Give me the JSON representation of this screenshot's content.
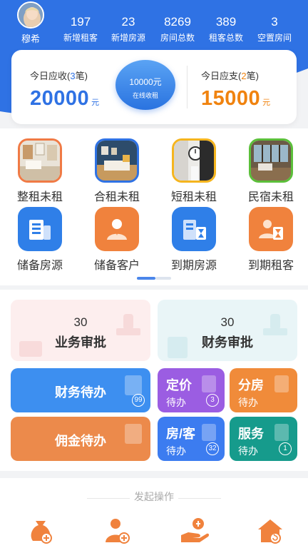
{
  "user": {
    "name": "穆希"
  },
  "stats": [
    {
      "value": "197",
      "label": "新增租客"
    },
    {
      "value": "23",
      "label": "新增房源"
    },
    {
      "value": "8269",
      "label": "房间总数"
    },
    {
      "value": "389",
      "label": "租客总数"
    },
    {
      "value": "3",
      "label": "空置房间"
    }
  ],
  "finance": {
    "receivable": {
      "label_prefix": "今日应收(",
      "count": "3",
      "label_suffix": "笔)",
      "amount": "20000",
      "unit": "元"
    },
    "payable": {
      "label_prefix": "今日应支(",
      "count": "2",
      "label_suffix": "笔)",
      "amount": "15000",
      "unit": "元"
    },
    "online": {
      "amount": "10000元",
      "label": "在线收租"
    }
  },
  "tiles_row1": [
    {
      "label": "整租未租",
      "icon": "whole-rent-photo",
      "border": "#f07a45"
    },
    {
      "label": "合租未租",
      "icon": "shared-rent-photo",
      "border": "#2f72e4"
    },
    {
      "label": "短租未租",
      "icon": "short-rent-photo",
      "border": "#f5b51e"
    },
    {
      "label": "民宿未租",
      "icon": "homestay-photo",
      "border": "#5bbf3a"
    }
  ],
  "tiles_row2": [
    {
      "label": "储备房源",
      "icon": "building-icon"
    },
    {
      "label": "储备客户",
      "icon": "customer-icon"
    },
    {
      "label": "到期房源",
      "icon": "expiring-building-icon"
    },
    {
      "label": "到期租客",
      "icon": "expiring-tenant-icon"
    }
  ],
  "approvals": [
    {
      "count": "30",
      "label": "业务审批",
      "bg": "#fdeeee"
    },
    {
      "count": "30",
      "label": "财务审批",
      "bg": "#e9f5f7"
    }
  ],
  "todos": {
    "finance": {
      "label": "财务待办",
      "badge": "99",
      "color": "#3d8ff0"
    },
    "commission": {
      "label": "佣金待办",
      "color": "#ec8a4b"
    },
    "pricing": {
      "line1": "定价",
      "line2": "待办",
      "badge": "3",
      "color": "#9b5de2"
    },
    "assign": {
      "line1": "分房",
      "line2": "待办",
      "color": "#f08b3a"
    },
    "room_tenant": {
      "line1": "房/客",
      "line2": "待办",
      "badge": "32",
      "color": "#3c7cf0"
    },
    "service": {
      "line1": "服务",
      "line2": "待办",
      "badge": "1",
      "color": "#169b8c"
    }
  },
  "operations": {
    "title": "发起操作",
    "icons": [
      "money-bag-add-icon",
      "person-add-icon",
      "hand-pay-icon",
      "house-return-icon"
    ]
  }
}
